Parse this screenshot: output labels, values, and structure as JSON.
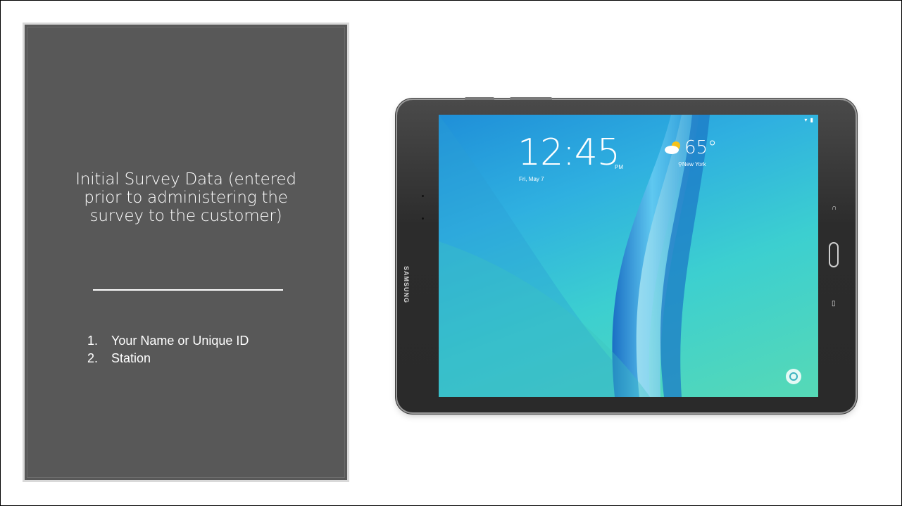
{
  "left_panel": {
    "title": "Initial Survey Data (entered\nprior to administering the\nsurvey to the customer)",
    "list": [
      {
        "num": "1.",
        "text": "Your Name or Unique ID"
      },
      {
        "num": "2.",
        "text": "Station"
      }
    ]
  },
  "tablet": {
    "brand": "SAMSUNG",
    "screen": {
      "time": "12:45",
      "ampm": "PM",
      "date": "Fri, May 7",
      "temperature": "65°",
      "location": "New York",
      "weather_icon": "partly-cloudy-icon"
    }
  },
  "colors": {
    "panel_bg": "#585858",
    "panel_border": "#d9d9d9",
    "screen_blue": "#1f8fd8",
    "screen_teal": "#56d9b6"
  }
}
